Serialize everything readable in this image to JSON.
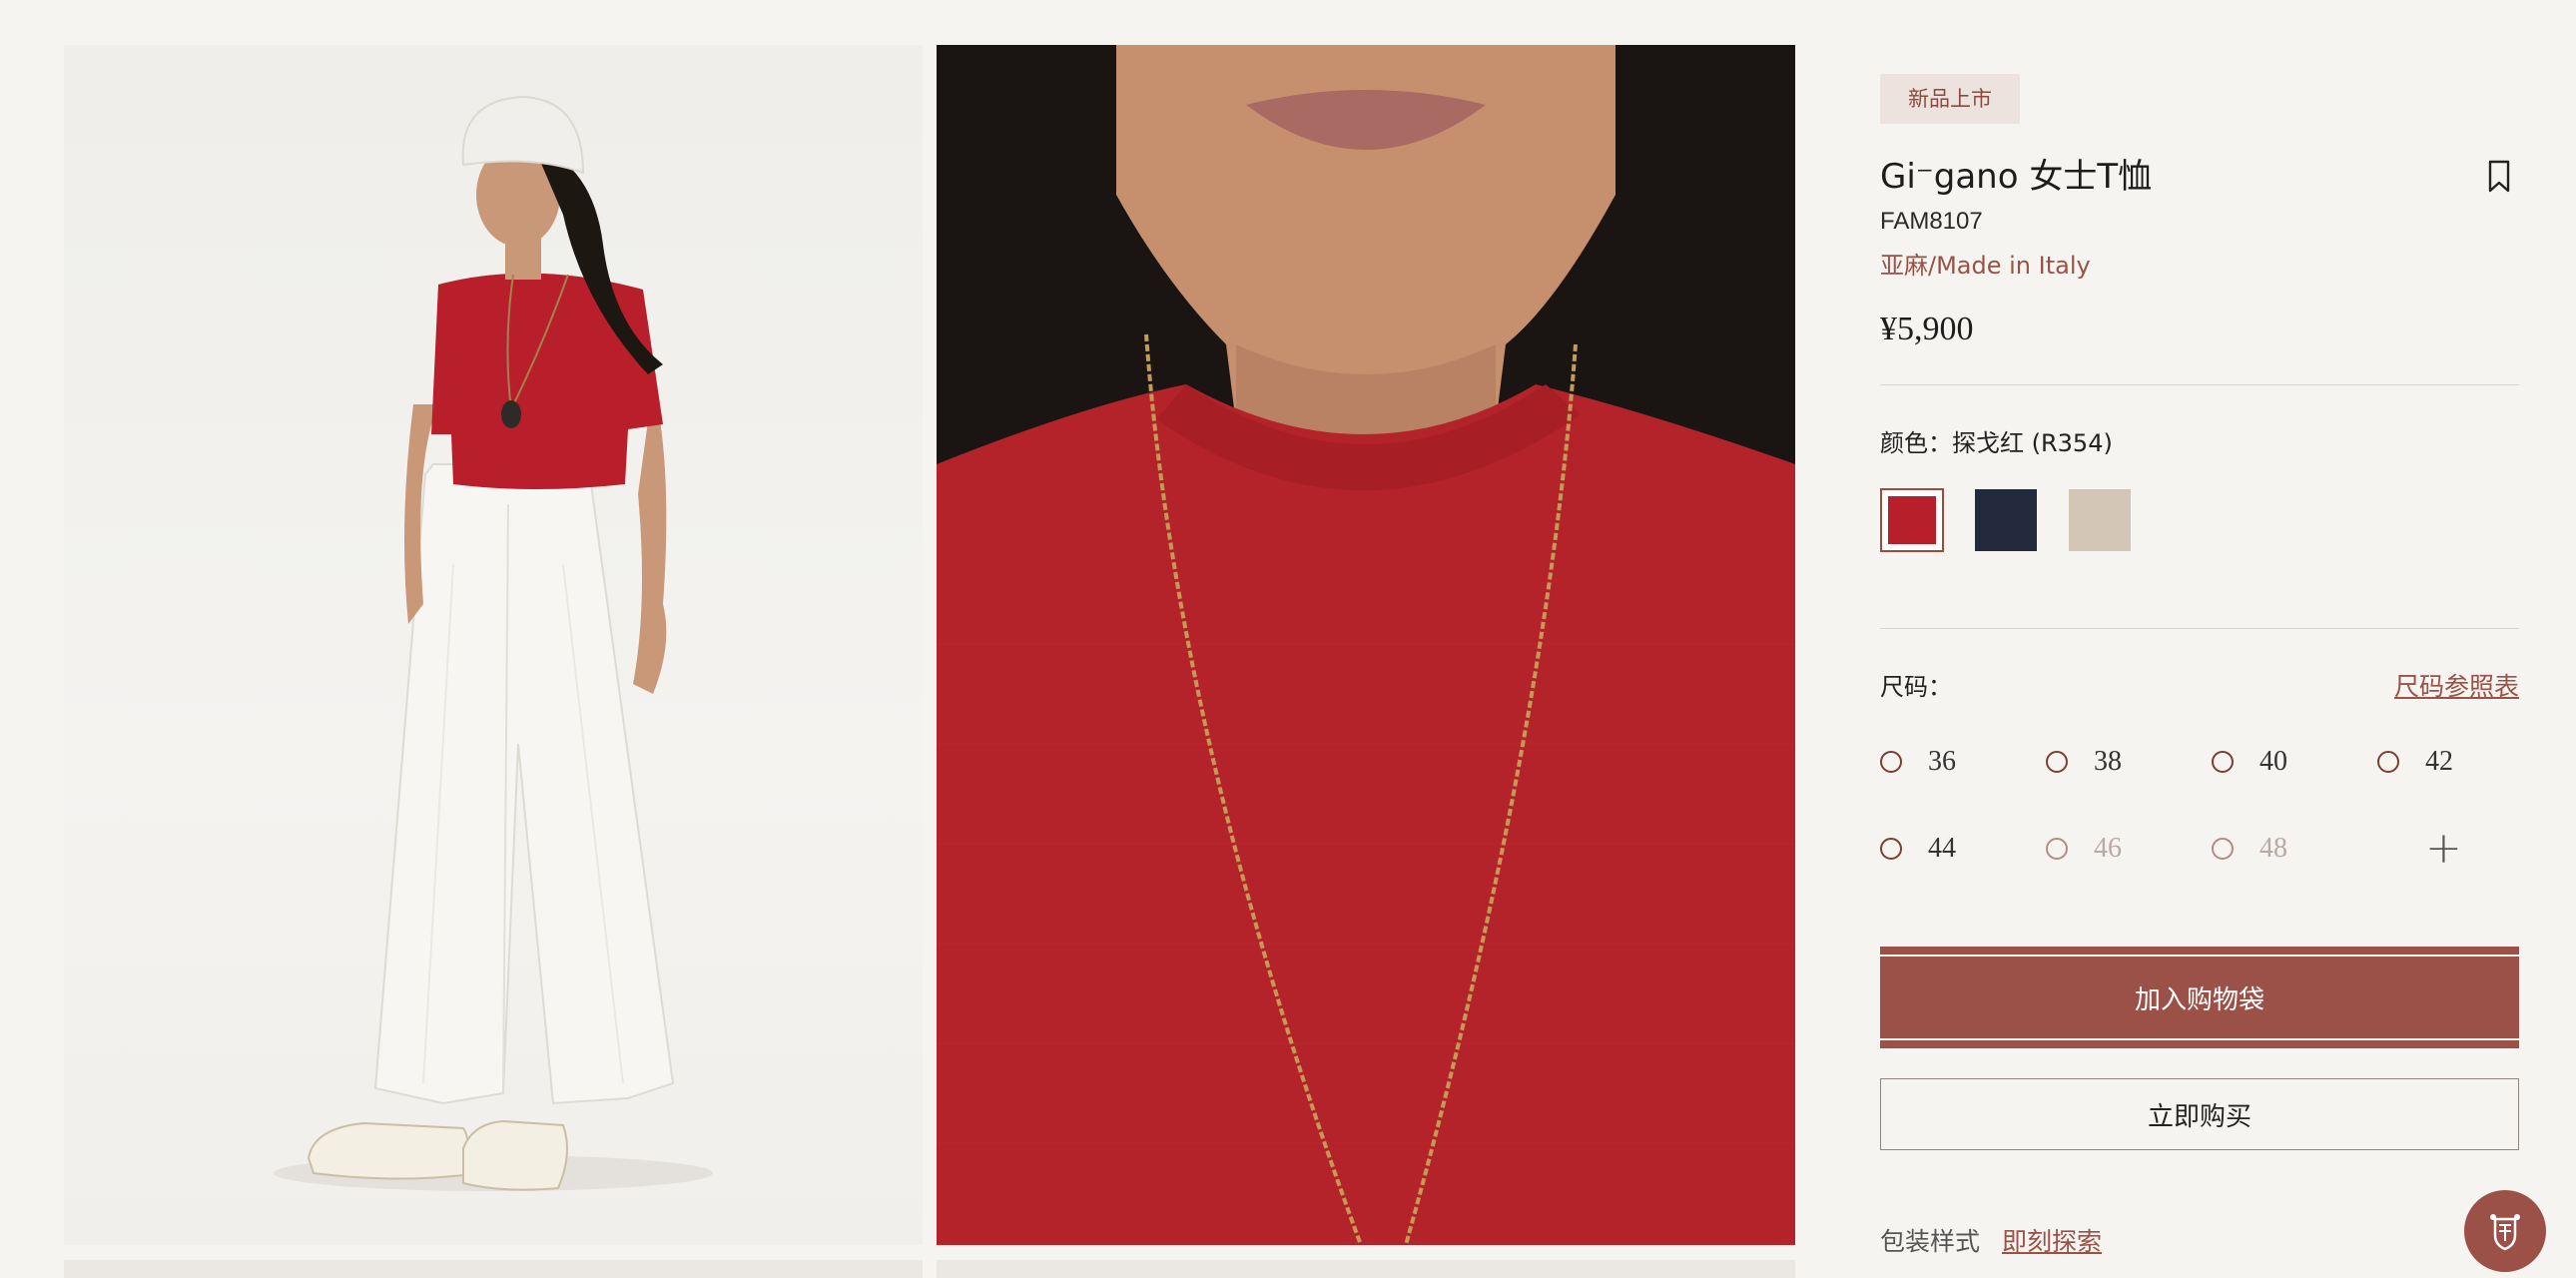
{
  "gallery": {
    "images": [
      {
        "alt": "model-full-body"
      },
      {
        "alt": "tshirt-collar-detail"
      }
    ]
  },
  "product": {
    "badge": "新品上市",
    "title": "Gi⁻gano 女士T恤",
    "sku": "FAM8107",
    "material": "亚麻/Made in Italy",
    "price": "¥5,900",
    "color_label": "颜色：探戈红 (R354)",
    "swatches": [
      {
        "name": "探戈红",
        "hex": "#b81f2a",
        "selected": true
      },
      {
        "name": "navy",
        "hex": "#242a3d",
        "selected": false
      },
      {
        "name": "beige",
        "hex": "#d4c6b6",
        "selected": false
      }
    ],
    "size_label": "尺码：",
    "size_chart": "尺码参照表",
    "sizes": [
      {
        "label": "36",
        "available": true
      },
      {
        "label": "38",
        "available": true
      },
      {
        "label": "40",
        "available": true
      },
      {
        "label": "42",
        "available": true
      },
      {
        "label": "44",
        "available": true
      },
      {
        "label": "46",
        "available": false
      },
      {
        "label": "48",
        "available": false
      }
    ],
    "more_sizes_icon": "plus-icon",
    "add_to_bag": "加入购物袋",
    "buy_now": "立即购买",
    "wrap_label": "包装样式",
    "wrap_link": "即刻探索"
  },
  "colors": {
    "accent": "#9b5148",
    "accent_text": "#9a5146",
    "background": "#f6f4f1"
  },
  "chat": {
    "icon": "chat-crest-icon"
  },
  "bookmark": {
    "icon": "bookmark-icon"
  }
}
